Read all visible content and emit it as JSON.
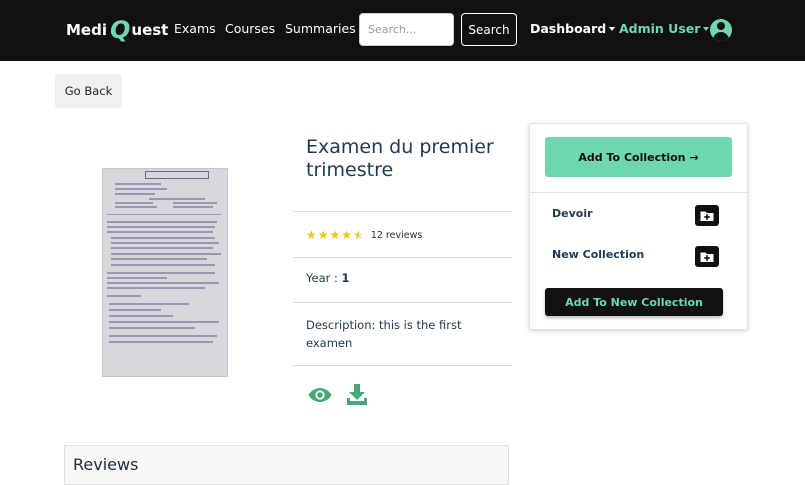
{
  "navbar": {
    "brand_prefix": "Medi",
    "brand_q": "Q",
    "brand_suffix": "uest",
    "links": [
      "Exams",
      "Courses",
      "Summaries"
    ],
    "search_placeholder": "Search...",
    "search_button": "Search",
    "dashboard_label": "Dashboard",
    "user_label": "Admin User"
  },
  "page": {
    "go_back": "Go Back"
  },
  "exam": {
    "title": "Examen du premier trimestre",
    "rating": 4.5,
    "reviews_count": "12 reviews",
    "year_label": "Year : ",
    "year_value": "1",
    "description": "Description: this is the first examen"
  },
  "collections": {
    "add_button": "Add To Collection",
    "items": [
      {
        "label": "Devoir"
      },
      {
        "label": "New Collection"
      }
    ],
    "new_button": "Add To New Collection"
  },
  "reviews": {
    "title": "Reviews"
  },
  "colors": {
    "accent": "#6fd7ad",
    "navbar": "#111111",
    "star": "#f1c40f",
    "icon_green": "#45a97c"
  },
  "icons": [
    "user-avatar-icon",
    "star-icon",
    "eye-icon",
    "download-icon",
    "folder-plus-icon",
    "arrow-right-icon"
  ]
}
